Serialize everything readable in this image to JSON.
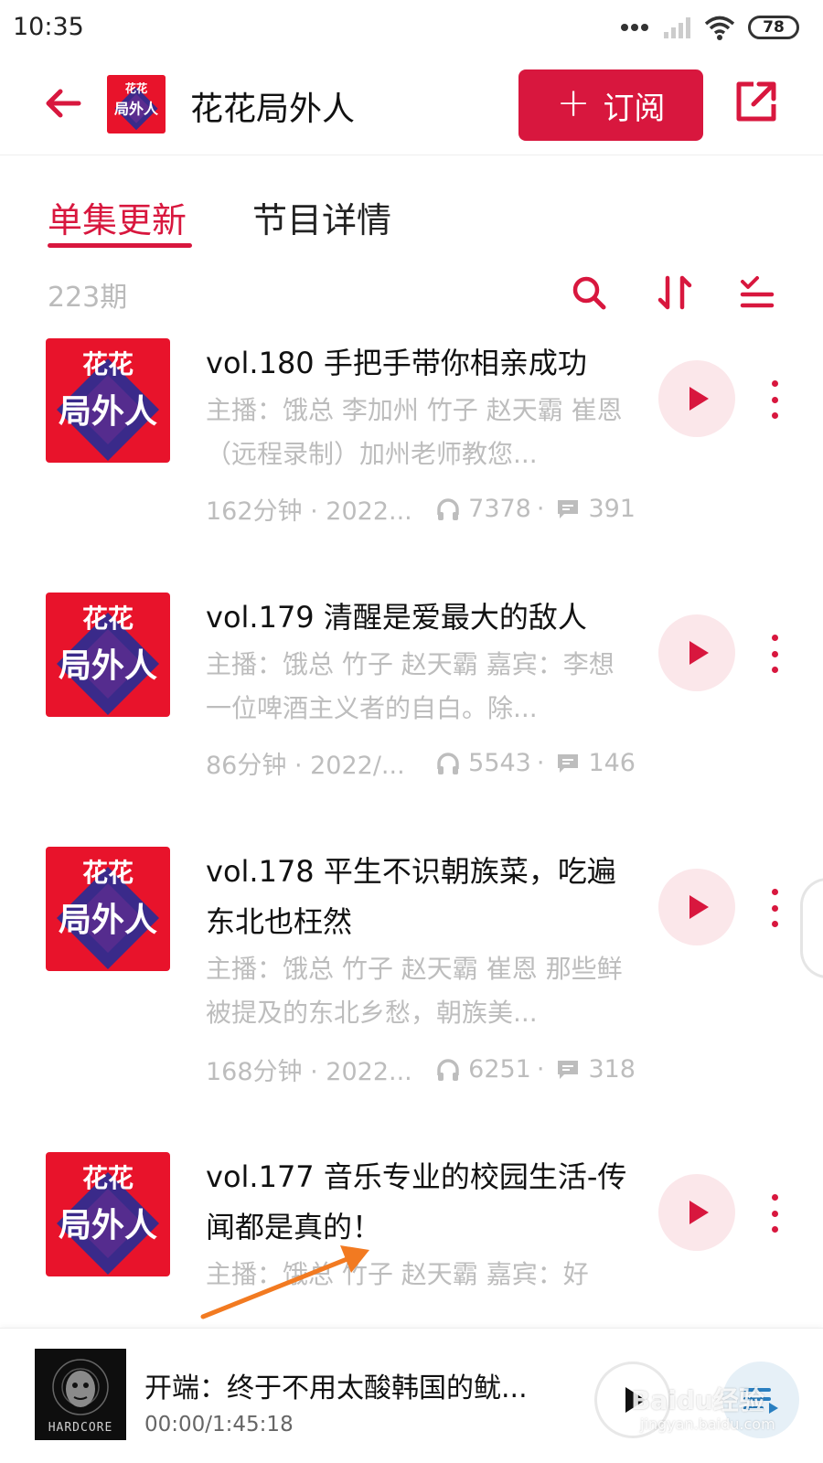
{
  "status_bar": {
    "time": "10:35",
    "battery": "78"
  },
  "header": {
    "title": "花花局外人",
    "subscribe_label": "订阅"
  },
  "tabs": [
    {
      "label": "单集更新"
    },
    {
      "label": "节目详情"
    }
  ],
  "toolbar": {
    "episode_count": "223期"
  },
  "episodes": [
    {
      "title": "vol.180 手把手带你相亲成功",
      "desc": "主播：饿总 李加州 竹子 赵天霸 崔恩（远程录制）加州老师教您...",
      "duration": "162分钟 · 2022...",
      "plays": "7378",
      "comments": "391"
    },
    {
      "title": "vol.179 清醒是爱最大的敌人",
      "desc": "主播：饿总 竹子 赵天霸 嘉宾：李想 一位啤酒主义者的自白。除...",
      "duration": "86分钟 · 2022/...",
      "plays": "5543",
      "comments": "146"
    },
    {
      "title": "vol.178 平生不识朝族菜，吃遍东北也枉然",
      "desc": "主播：饿总 竹子 赵天霸 崔恩 那些鲜被提及的东北乡愁，朝族美...",
      "duration": "168分钟 · 2022...",
      "plays": "6251",
      "comments": "318"
    },
    {
      "title": "vol.177 音乐专业的校园生活-传闻都是真的！",
      "desc": "主播：饿总 竹子 赵天霸 嘉宾：好"
    }
  ],
  "player": {
    "title": "开端：终于不用太酸韩国的鱿...",
    "time": "00:00/1:45:18",
    "cover_text": "HARDCORE"
  },
  "watermark": {
    "main": "Baidu经验",
    "sub": "jingyan.baidu.com"
  },
  "colors": {
    "accent": "#d8173e",
    "muted": "#bdbdbd"
  }
}
